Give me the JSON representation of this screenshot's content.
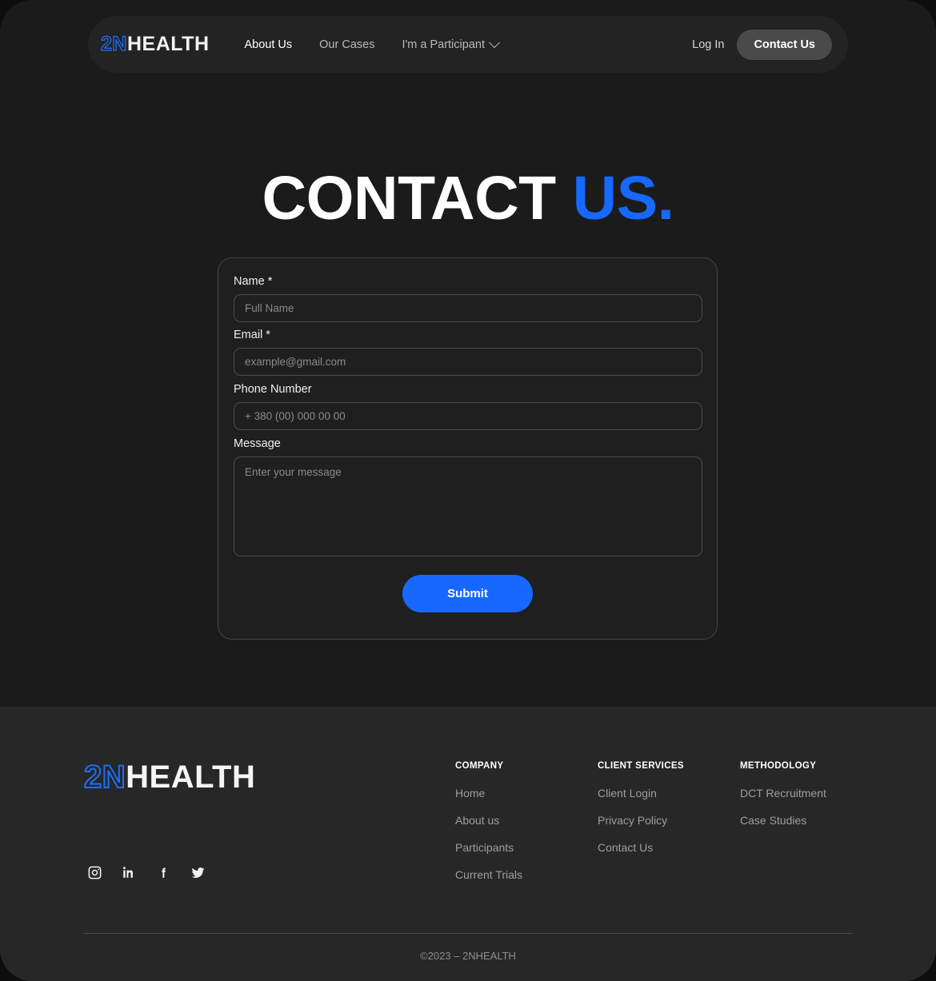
{
  "brand": {
    "mark": "2N",
    "word": "HEALTH"
  },
  "nav": {
    "links": [
      {
        "label": "About Us",
        "icon": null
      },
      {
        "label": "Our Cases",
        "icon": null
      },
      {
        "label": "I'm a Participant",
        "icon": "chevron-down-icon"
      }
    ],
    "login_label": "Log In",
    "contact_label": "Contact Us"
  },
  "hero": {
    "title_part1": "CONTACT ",
    "title_part2": "US."
  },
  "form": {
    "fields": [
      {
        "label": "Name *",
        "placeholder": "Full Name",
        "value": ""
      },
      {
        "label": "Email *",
        "placeholder": "example@gmail.com",
        "value": ""
      },
      {
        "label": "Phone Number",
        "placeholder": "+ 380 (00) 000 00 00",
        "value": ""
      },
      {
        "label": "Message",
        "placeholder": "Enter your message",
        "value": ""
      }
    ],
    "submit_label": "Submit"
  },
  "footer": {
    "socials": [
      {
        "name": "instagram-icon"
      },
      {
        "name": "linkedin-icon"
      },
      {
        "name": "facebook-icon"
      },
      {
        "name": "twitter-icon"
      }
    ],
    "columns": [
      {
        "title": "COMPANY",
        "links": [
          "Home",
          "About us",
          "Participants",
          "Current Trials"
        ]
      },
      {
        "title": "CLIENT SERVICES",
        "links": [
          "Client Login",
          "Privacy Policy",
          "Contact Us"
        ]
      },
      {
        "title": "METHODOLOGY",
        "links": [
          "DCT Recruitment",
          "Case Studies"
        ]
      }
    ],
    "copyright": "©2023 – 2NHEALTH"
  },
  "colors": {
    "accent_blue": "#1668ff",
    "logo_blue": "#1d6ff2",
    "page_bg": "#1b1b1b",
    "nav_bg": "#232323",
    "footer_bg": "#272727",
    "card_border": "#454545"
  }
}
